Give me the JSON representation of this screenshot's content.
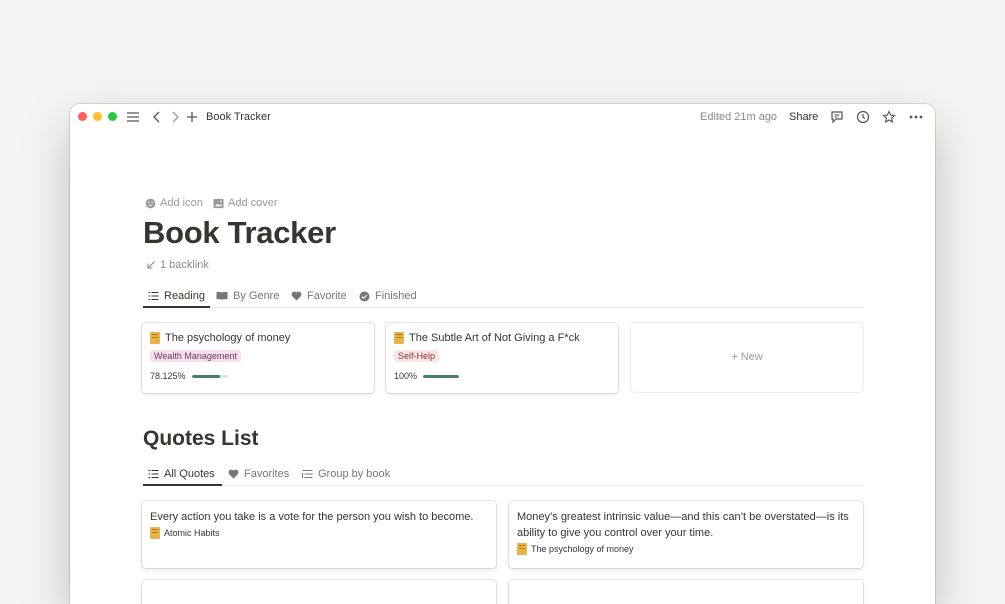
{
  "titlebar": {
    "page_title": "Book Tracker",
    "edited": "Edited 21m ago",
    "share": "Share"
  },
  "page": {
    "add_icon": "Add icon",
    "add_cover": "Add cover",
    "title": "Book Tracker",
    "backlink": "1 backlink"
  },
  "reading_tabs": [
    {
      "label": "Reading",
      "icon": "list-icon"
    },
    {
      "label": "By Genre",
      "icon": "book-open-icon"
    },
    {
      "label": "Favorite",
      "icon": "heart-icon"
    },
    {
      "label": "Finished",
      "icon": "check-circle-icon"
    }
  ],
  "books": [
    {
      "title": "The psychology of money",
      "tag": "Wealth Management",
      "tag_bg": "#f4dfeb",
      "tag_fg": "#6c3a5a",
      "progress_label": "78.125%",
      "progress": 0.78125
    },
    {
      "title": "The Subtle Art of Not Giving a F*ck",
      "tag": "Self-Help",
      "tag_bg": "#fbe4e4",
      "tag_fg": "#8a3a3a",
      "progress_label": "100%",
      "progress": 1.0
    }
  ],
  "new_card": {
    "label": "+ New"
  },
  "quotes_section": {
    "title": "Quotes List",
    "tabs": [
      {
        "label": "All Quotes",
        "icon": "list-icon"
      },
      {
        "label": "Favorites",
        "icon": "heart-icon"
      },
      {
        "label": "Group by book",
        "icon": "group-list-icon"
      }
    ],
    "quotes": [
      {
        "text": "Every action you take is a vote for the person you wish to become.",
        "source": "Atomic Habits"
      },
      {
        "text": "Money’s greatest intrinsic value—and this can’t be overstated—is its ability to give you control over your time.",
        "source": "The psychology of money"
      }
    ]
  },
  "colors": {
    "accent_progress": "#448361",
    "text": "#37352f",
    "muted": "#9b9a97"
  }
}
